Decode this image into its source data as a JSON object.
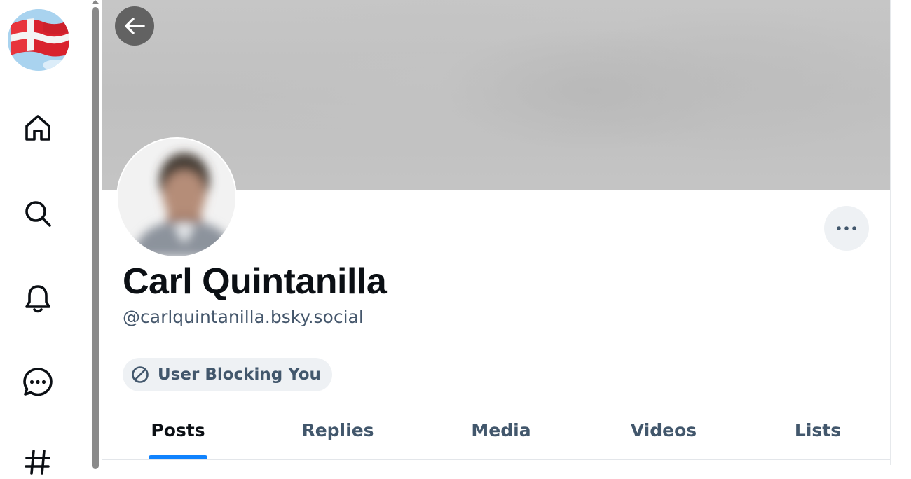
{
  "sidebar": {
    "avatar_icon": "denmark-flag-avatar",
    "items": [
      {
        "name": "home",
        "icon": "home-icon"
      },
      {
        "name": "search",
        "icon": "search-icon"
      },
      {
        "name": "notifications",
        "icon": "bell-icon"
      },
      {
        "name": "chat",
        "icon": "chat-icon"
      },
      {
        "name": "feeds",
        "icon": "hashtag-icon"
      }
    ]
  },
  "profile": {
    "display_name": "Carl Quintanilla",
    "handle": "@carlquintanilla.bsky.social",
    "blocking_label": "User Blocking You",
    "more_icon": "ellipsis-icon",
    "back_icon": "arrow-left-icon"
  },
  "tabs": [
    {
      "label": "Posts",
      "active": true
    },
    {
      "label": "Replies",
      "active": false
    },
    {
      "label": "Media",
      "active": false
    },
    {
      "label": "Videos",
      "active": false
    },
    {
      "label": "Lists",
      "active": false
    }
  ],
  "colors": {
    "accent": "#1083fe",
    "text_primary": "#0b0f14",
    "text_secondary": "#42576c",
    "pill_bg": "#eef1f4",
    "banner_gray": "#c4c4c4"
  }
}
